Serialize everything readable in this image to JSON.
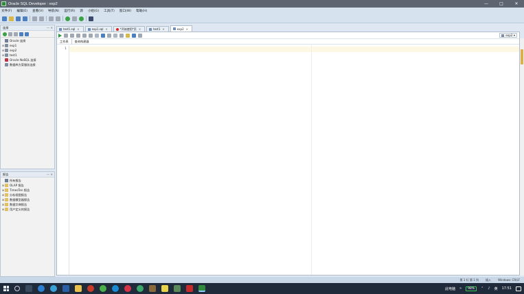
{
  "window": {
    "title": "Oracle SQL Developer : exp2",
    "controls": [
      "—",
      "□",
      "✕"
    ]
  },
  "menu": [
    "文件(F)",
    "编辑(E)",
    "查看(V)",
    "导航(N)",
    "运行(R)",
    "源",
    "小组(G)",
    "工具(T)",
    "窗口(W)",
    "帮助(H)"
  ],
  "connections_panel": {
    "title": "连接",
    "items": [
      {
        "label": "Oracle 连接",
        "type": "root",
        "expand": ""
      },
      {
        "label": "exp1",
        "type": "conn",
        "expand": "⊞"
      },
      {
        "label": "exp2",
        "type": "conn",
        "expand": "⊞"
      },
      {
        "label": "test1",
        "type": "conn",
        "expand": "⊞"
      },
      {
        "label": "Oracle NoSQL 连接",
        "type": "db",
        "expand": ""
      },
      {
        "label": "数据库方案服务连接",
        "type": "conn",
        "expand": ""
      }
    ]
  },
  "reports_panel": {
    "title": "报告",
    "items": [
      {
        "label": "所有报告",
        "type": "root",
        "expand": ""
      },
      {
        "label": "OLAP 报告",
        "type": "folder",
        "expand": "⊞"
      },
      {
        "label": "TimesTen 报告",
        "type": "folder",
        "expand": "⊞"
      },
      {
        "label": "分析视图报告",
        "type": "folder",
        "expand": "⊞"
      },
      {
        "label": "数据模型器报告",
        "type": "folder",
        "expand": "⊞"
      },
      {
        "label": "数据字典报告",
        "type": "folder",
        "expand": "⊞"
      },
      {
        "label": "用户定义的报告",
        "type": "folder",
        "expand": "⊞"
      }
    ]
  },
  "editor_tabs": [
    {
      "label": "test1.sql",
      "type": "sql",
      "active": false
    },
    {
      "label": "exp1.sql",
      "type": "sql",
      "active": false
    },
    {
      "label": "*开始使用*页",
      "type": "start",
      "active": false
    },
    {
      "label": "test1",
      "type": "sql",
      "active": false
    },
    {
      "label": "exp2",
      "type": "sql",
      "active": true
    }
  ],
  "editor": {
    "connection": "exp2",
    "subtabs": [
      "工作表",
      "查询构建器"
    ],
    "line_numbers": [
      "1"
    ]
  },
  "statusbar": {
    "position": "第 1 行 第 1 列",
    "mode": "插入",
    "encoding": "Windows: CR/LF"
  },
  "taskbar": {
    "computer": "此电脑",
    "battery": "98%",
    "ime": "英",
    "time": "17:51"
  }
}
